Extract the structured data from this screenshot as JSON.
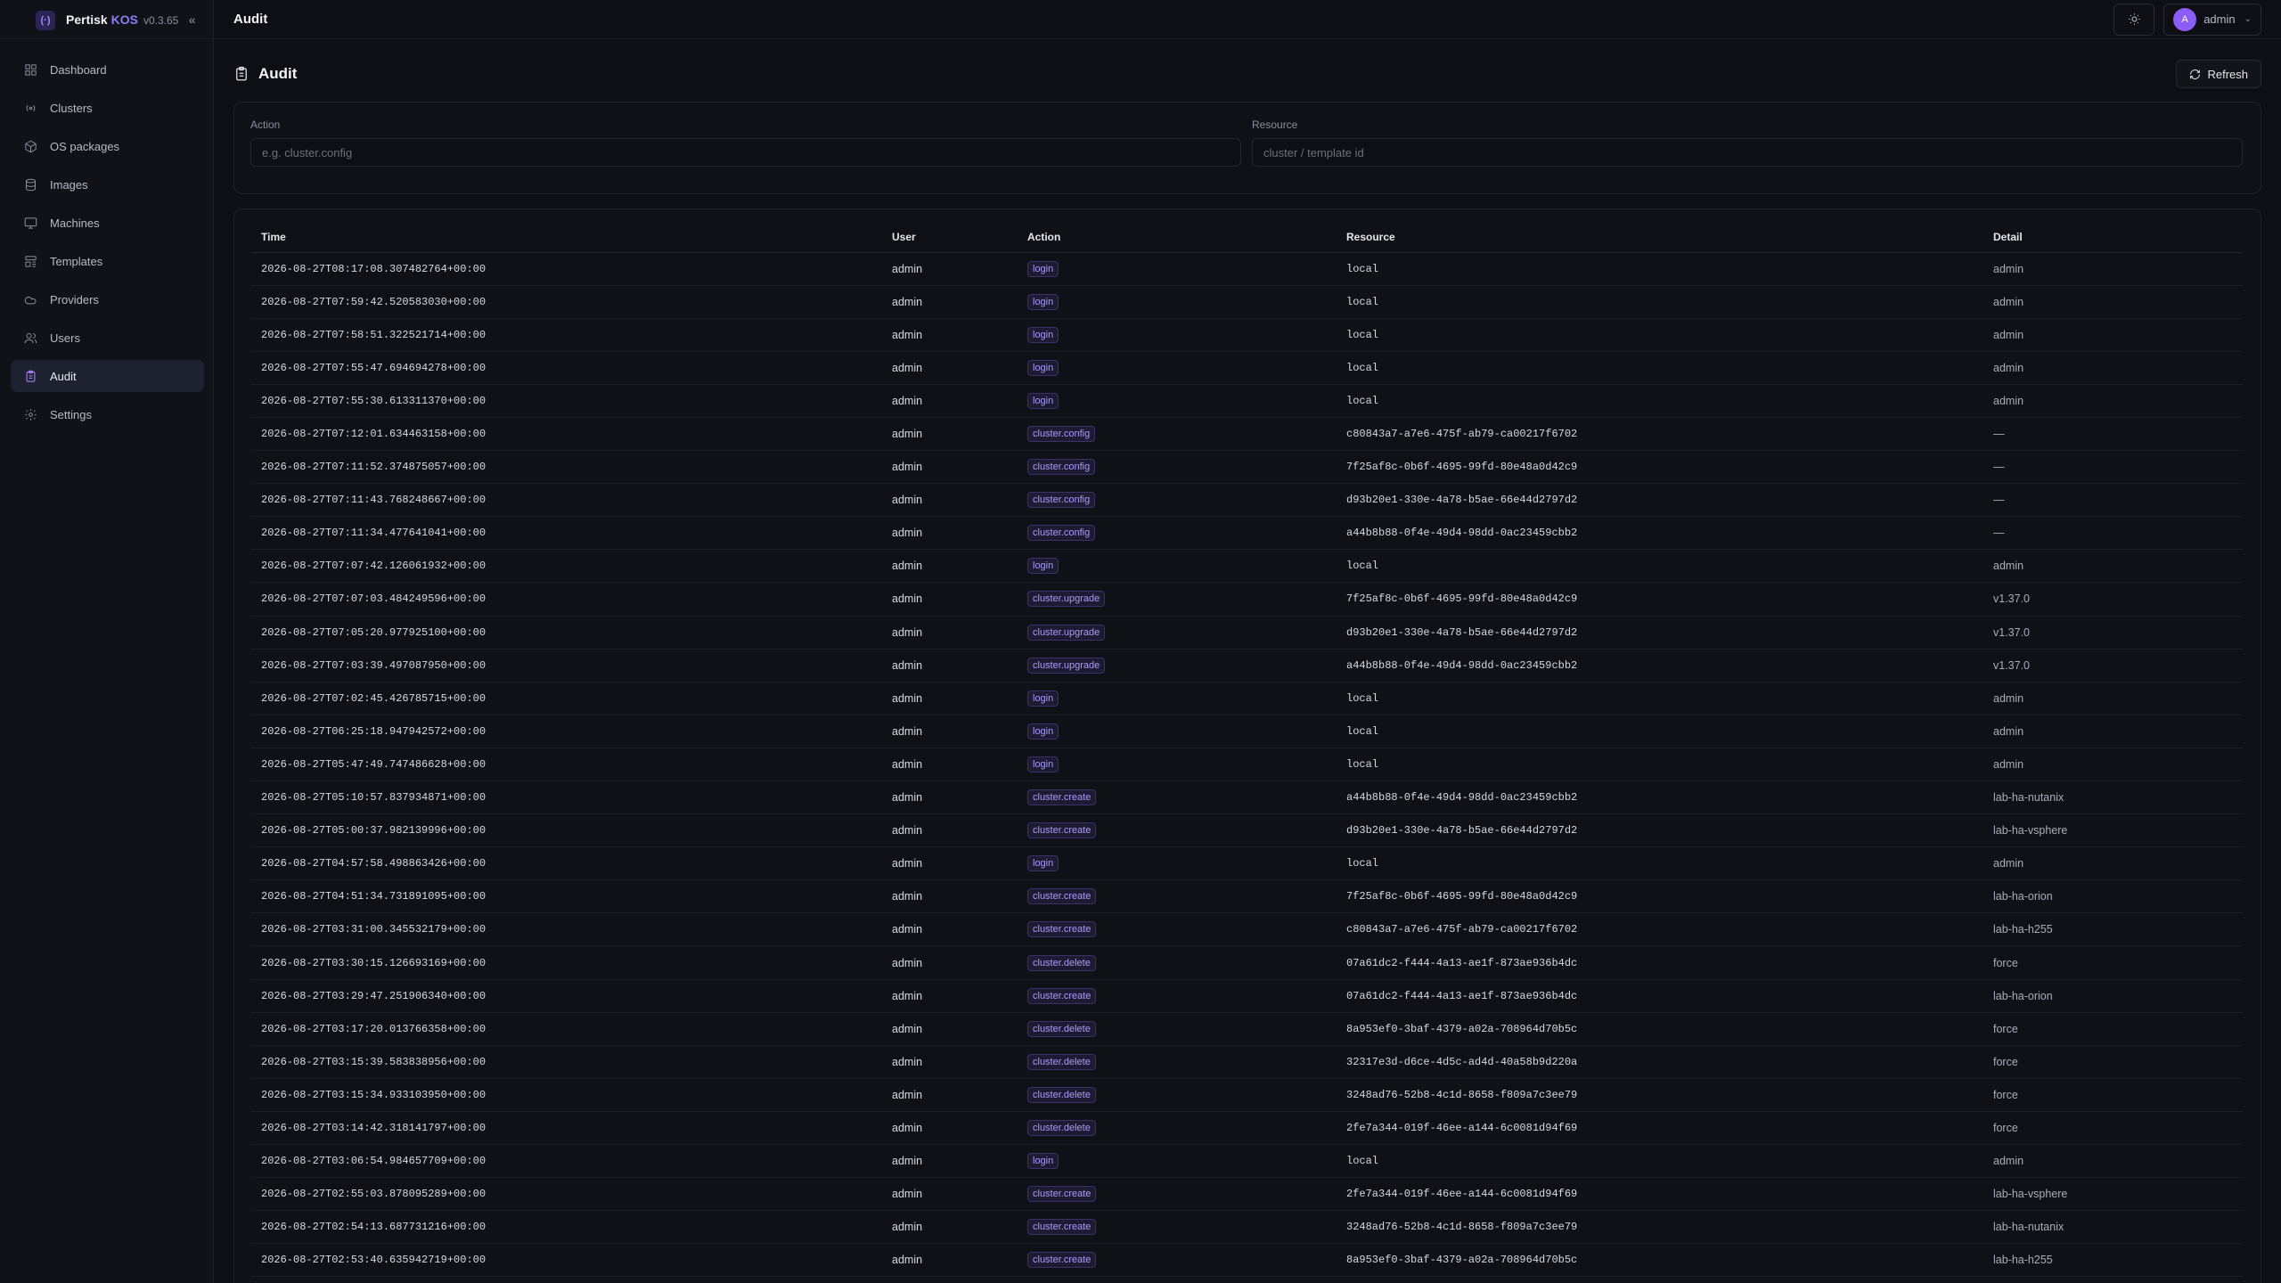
{
  "brand": {
    "name": "Pertisk",
    "product": "KOS",
    "version": "v0.3.65",
    "logo": "(·)"
  },
  "sidebar": {
    "items": [
      {
        "label": "Dashboard",
        "icon": "dashboard-icon"
      },
      {
        "label": "Clusters",
        "icon": "clusters-icon"
      },
      {
        "label": "OS packages",
        "icon": "package-icon"
      },
      {
        "label": "Images",
        "icon": "database-icon"
      },
      {
        "label": "Machines",
        "icon": "monitor-icon"
      },
      {
        "label": "Templates",
        "icon": "template-icon"
      },
      {
        "label": "Providers",
        "icon": "cloud-icon"
      },
      {
        "label": "Users",
        "icon": "users-icon"
      },
      {
        "label": "Audit",
        "icon": "clipboard-icon",
        "active": true
      },
      {
        "label": "Settings",
        "icon": "gear-icon"
      }
    ]
  },
  "topbar": {
    "title": "Audit",
    "user": "admin",
    "avatar_initial": "A"
  },
  "page": {
    "title": "Audit",
    "refresh_label": "Refresh"
  },
  "filters": {
    "action_label": "Action",
    "action_placeholder": "e.g. cluster.config",
    "resource_label": "Resource",
    "resource_placeholder": "cluster / template id"
  },
  "table": {
    "headers": [
      "Time",
      "User",
      "Action",
      "Resource",
      "Detail"
    ],
    "rows": [
      [
        "2026-08-27T08:17:08.307482764+00:00",
        "admin",
        "login",
        "local",
        "admin"
      ],
      [
        "2026-08-27T07:59:42.520583030+00:00",
        "admin",
        "login",
        "local",
        "admin"
      ],
      [
        "2026-08-27T07:58:51.322521714+00:00",
        "admin",
        "login",
        "local",
        "admin"
      ],
      [
        "2026-08-27T07:55:47.694694278+00:00",
        "admin",
        "login",
        "local",
        "admin"
      ],
      [
        "2026-08-27T07:55:30.613311370+00:00",
        "admin",
        "login",
        "local",
        "admin"
      ],
      [
        "2026-08-27T07:12:01.634463158+00:00",
        "admin",
        "cluster.config",
        "c80843a7-a7e6-475f-ab79-ca00217f6702",
        "—"
      ],
      [
        "2026-08-27T07:11:52.374875057+00:00",
        "admin",
        "cluster.config",
        "7f25af8c-0b6f-4695-99fd-80e48a0d42c9",
        "—"
      ],
      [
        "2026-08-27T07:11:43.768248667+00:00",
        "admin",
        "cluster.config",
        "d93b20e1-330e-4a78-b5ae-66e44d2797d2",
        "—"
      ],
      [
        "2026-08-27T07:11:34.477641041+00:00",
        "admin",
        "cluster.config",
        "a44b8b88-0f4e-49d4-98dd-0ac23459cbb2",
        "—"
      ],
      [
        "2026-08-27T07:07:42.126061932+00:00",
        "admin",
        "login",
        "local",
        "admin"
      ],
      [
        "2026-08-27T07:07:03.484249596+00:00",
        "admin",
        "cluster.upgrade",
        "7f25af8c-0b6f-4695-99fd-80e48a0d42c9",
        "v1.37.0"
      ],
      [
        "2026-08-27T07:05:20.977925100+00:00",
        "admin",
        "cluster.upgrade",
        "d93b20e1-330e-4a78-b5ae-66e44d2797d2",
        "v1.37.0"
      ],
      [
        "2026-08-27T07:03:39.497087950+00:00",
        "admin",
        "cluster.upgrade",
        "a44b8b88-0f4e-49d4-98dd-0ac23459cbb2",
        "v1.37.0"
      ],
      [
        "2026-08-27T07:02:45.426785715+00:00",
        "admin",
        "login",
        "local",
        "admin"
      ],
      [
        "2026-08-27T06:25:18.947942572+00:00",
        "admin",
        "login",
        "local",
        "admin"
      ],
      [
        "2026-08-27T05:47:49.747486628+00:00",
        "admin",
        "login",
        "local",
        "admin"
      ],
      [
        "2026-08-27T05:10:57.837934871+00:00",
        "admin",
        "cluster.create",
        "a44b8b88-0f4e-49d4-98dd-0ac23459cbb2",
        "lab-ha-nutanix"
      ],
      [
        "2026-08-27T05:00:37.982139996+00:00",
        "admin",
        "cluster.create",
        "d93b20e1-330e-4a78-b5ae-66e44d2797d2",
        "lab-ha-vsphere"
      ],
      [
        "2026-08-27T04:57:58.498863426+00:00",
        "admin",
        "login",
        "local",
        "admin"
      ],
      [
        "2026-08-27T04:51:34.731891095+00:00",
        "admin",
        "cluster.create",
        "7f25af8c-0b6f-4695-99fd-80e48a0d42c9",
        "lab-ha-orion"
      ],
      [
        "2026-08-27T03:31:00.345532179+00:00",
        "admin",
        "cluster.create",
        "c80843a7-a7e6-475f-ab79-ca00217f6702",
        "lab-ha-h255"
      ],
      [
        "2026-08-27T03:30:15.126693169+00:00",
        "admin",
        "cluster.delete",
        "07a61dc2-f444-4a13-ae1f-873ae936b4dc",
        "force"
      ],
      [
        "2026-08-27T03:29:47.251906340+00:00",
        "admin",
        "cluster.create",
        "07a61dc2-f444-4a13-ae1f-873ae936b4dc",
        "lab-ha-orion"
      ],
      [
        "2026-08-27T03:17:20.013766358+00:00",
        "admin",
        "cluster.delete",
        "8a953ef0-3baf-4379-a02a-708964d70b5c",
        "force"
      ],
      [
        "2026-08-27T03:15:39.583838956+00:00",
        "admin",
        "cluster.delete",
        "32317e3d-d6ce-4d5c-ad4d-40a58b9d220a",
        "force"
      ],
      [
        "2026-08-27T03:15:34.933103950+00:00",
        "admin",
        "cluster.delete",
        "3248ad76-52b8-4c1d-8658-f809a7c3ee79",
        "force"
      ],
      [
        "2026-08-27T03:14:42.318141797+00:00",
        "admin",
        "cluster.delete",
        "2fe7a344-019f-46ee-a144-6c0081d94f69",
        "force"
      ],
      [
        "2026-08-27T03:06:54.984657709+00:00",
        "admin",
        "login",
        "local",
        "admin"
      ],
      [
        "2026-08-27T02:55:03.878095289+00:00",
        "admin",
        "cluster.create",
        "2fe7a344-019f-46ee-a144-6c0081d94f69",
        "lab-ha-vsphere"
      ],
      [
        "2026-08-27T02:54:13.687731216+00:00",
        "admin",
        "cluster.create",
        "3248ad76-52b8-4c1d-8658-f809a7c3ee79",
        "lab-ha-nutanix"
      ],
      [
        "2026-08-27T02:53:40.635942719+00:00",
        "admin",
        "cluster.create",
        "8a953ef0-3baf-4379-a02a-708964d70b5c",
        "lab-ha-h255"
      ]
    ]
  }
}
